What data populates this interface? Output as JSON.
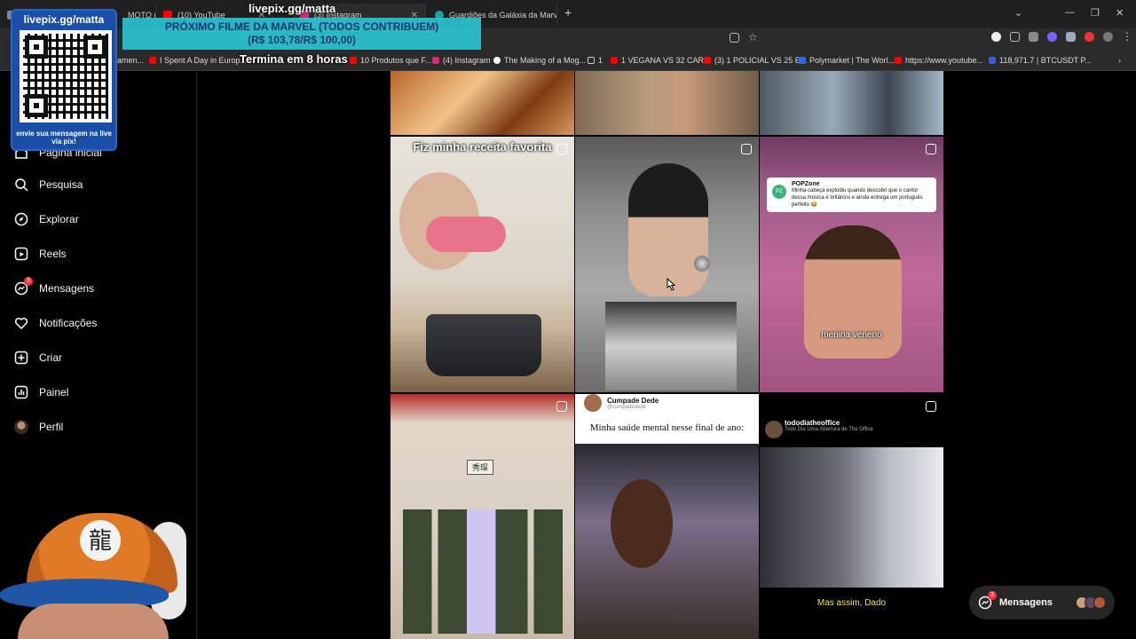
{
  "browser": {
    "tabs": [
      {
        "label": "MOTO (EX",
        "color": "#888888"
      },
      {
        "label": "(10) YouTube",
        "color": "#ff0000"
      },
      {
        "label": "(3) Instagram",
        "color": "#d62976"
      },
      {
        "label": "Guardiões da Galáxia da Marvel",
        "color": "#1aa3a3"
      }
    ],
    "bookmarks": [
      {
        "label": "amen...",
        "color": "#ff0000"
      },
      {
        "label": "I Spent A Day in Europ...",
        "color": "#ff0000"
      },
      {
        "label": "10 Produtos que F...",
        "color": "#ff0000"
      },
      {
        "label": "(4) Instagram",
        "color": "#d62976"
      },
      {
        "label": "The Making of a Mog...",
        "color": "#ffffff"
      },
      {
        "label": "1",
        "color": "#888888"
      },
      {
        "label": "1 VEGANA VS 32 CAR...",
        "color": "#ff0000"
      },
      {
        "label": "(3) 1 POLICIAL VS 25 E...",
        "color": "#ff0000"
      },
      {
        "label": "Polymarket | The Worl...",
        "color": "#2a6cf0"
      },
      {
        "label": "https://www.youtube...",
        "color": "#ff0000"
      },
      {
        "label": "118,971.7 | BTCUSDT P...",
        "color": "#3b5bdb"
      }
    ]
  },
  "sidebar": {
    "items": [
      {
        "label": "Página inicial",
        "icon": "home-icon"
      },
      {
        "label": "Pesquisa",
        "icon": "search-icon"
      },
      {
        "label": "Explorar",
        "icon": "compass-icon"
      },
      {
        "label": "Reels",
        "icon": "reels-icon"
      },
      {
        "label": "Mensagens",
        "icon": "messenger-icon",
        "badge": "3"
      },
      {
        "label": "Notificações",
        "icon": "heart-icon"
      },
      {
        "label": "Criar",
        "icon": "plus-square-icon"
      },
      {
        "label": "Painel",
        "icon": "bar-chart-icon"
      },
      {
        "label": "Perfil",
        "icon": "avatar"
      }
    ]
  },
  "feed": {
    "tile_recipe_caption": "Fiz minha receita favorita",
    "tweet": {
      "name": "POPZone",
      "text": "Minha cabeça explodiu quando descobri que o cantor dessa música é britânico e ainda entrega um português perfeito 😂"
    },
    "menina_caption": "menina veneno",
    "china_sign": "秀琛",
    "cumpade": {
      "name": "Cumpade Dede",
      "handle": "@cumpadedede",
      "text": "Minha saúde mental nesse final de ano:"
    },
    "office": {
      "name": "tododiatheoffice",
      "subtitle": "Todo Dia Uma Abertura de The Office",
      "caption": "Mas assim, Dado"
    }
  },
  "messages_pill": {
    "label": "Mensagens",
    "badge": "3"
  },
  "stream_overlay": {
    "handle": "livepix.gg/matta",
    "banner_line1": "PRÓXIMO FILME DA MARVEL (TODOS CONTRIBUEM)",
    "banner_line2": "(R$ 103,78/R$ 100,00)",
    "ends_text": "Termina em 8 horas",
    "qr_title": "livepix.gg/matta",
    "qr_text": "envie sua mensagem na live via pix!"
  }
}
